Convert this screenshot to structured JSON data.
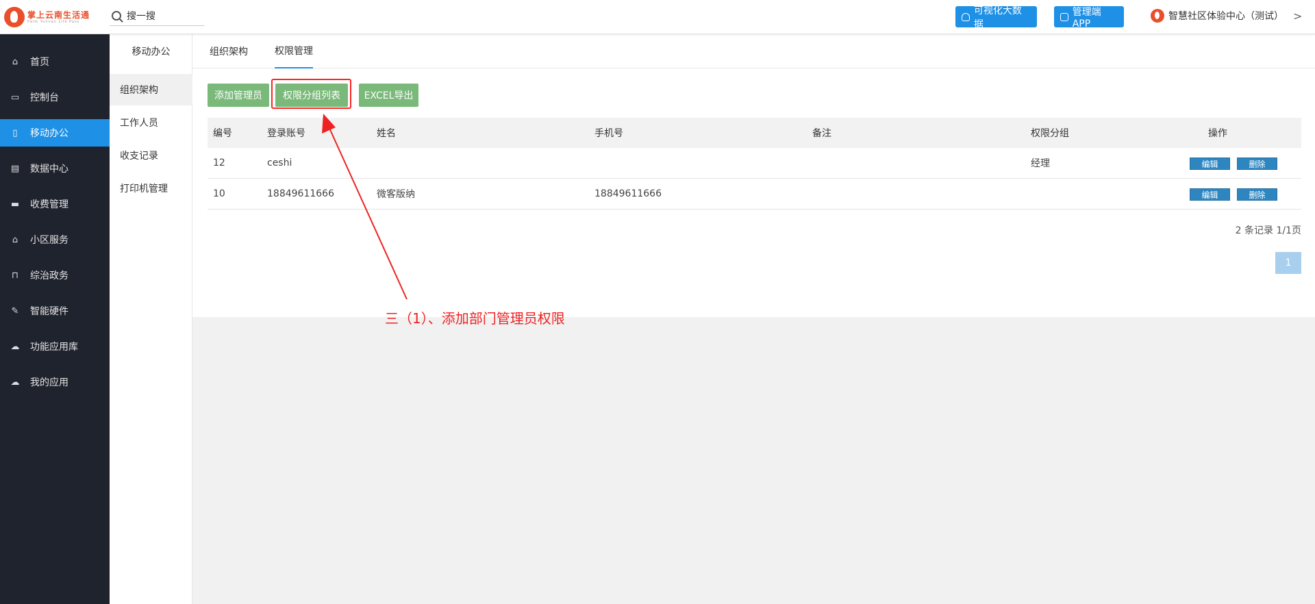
{
  "header": {
    "logo_text": "掌上云南生活通",
    "logo_subtext": "Palm Yunnan Life Pass",
    "search_label": "搜一搜",
    "btn_bigdata": "可视化大数据",
    "btn_app": "管理端APP",
    "org_name": "智慧社区体验中心（测试）",
    "org_chevron": ">"
  },
  "sidebar": {
    "items": [
      {
        "label": "首页",
        "icon": "home-icon",
        "glyph": "⌂"
      },
      {
        "label": "控制台",
        "icon": "laptop-icon",
        "glyph": "▭"
      },
      {
        "label": "移动办公",
        "icon": "mobile-icon",
        "glyph": "▯",
        "active": true
      },
      {
        "label": "数据中心",
        "icon": "briefcase-icon",
        "glyph": "▤"
      },
      {
        "label": "收费管理",
        "icon": "card-icon",
        "glyph": "▬"
      },
      {
        "label": "小区服务",
        "icon": "home-icon",
        "glyph": "⌂"
      },
      {
        "label": "综治政务",
        "icon": "bank-icon",
        "glyph": "⊓"
      },
      {
        "label": "智能硬件",
        "icon": "wrench-icon",
        "glyph": "✎"
      },
      {
        "label": "功能应用库",
        "icon": "cloud-upload-icon",
        "glyph": "☁"
      },
      {
        "label": "我的应用",
        "icon": "cloud-icon",
        "glyph": "☁"
      }
    ]
  },
  "subnav": {
    "title": "移动办公",
    "items": [
      {
        "label": "组织架构",
        "active": true
      },
      {
        "label": "工作人员"
      },
      {
        "label": "收支记录"
      },
      {
        "label": "打印机管理"
      }
    ]
  },
  "tabs": [
    {
      "label": "组织架构"
    },
    {
      "label": "权限管理",
      "active": true
    }
  ],
  "toolbar": {
    "add_admin": "添加管理员",
    "perm_groups": "权限分组列表",
    "export": "EXCEL导出"
  },
  "table": {
    "headers": [
      "编号",
      "登录账号",
      "姓名",
      "手机号",
      "备注",
      "权限分组",
      "操作"
    ],
    "rows": [
      {
        "id": "12",
        "account": "ceshi",
        "name": "",
        "phone": "",
        "note": "",
        "group": "经理",
        "edit": "编辑",
        "delete": "删除"
      },
      {
        "id": "10",
        "account": "18849611666",
        "name": "微客版纳",
        "phone": "18849611666",
        "note": "",
        "group": "",
        "edit": "编辑",
        "delete": "删除"
      }
    ]
  },
  "pagination": {
    "info": "2 条记录 1/1页",
    "current": "1"
  },
  "annotation": {
    "text": "三（1）、添加部门管理员权限",
    "color": "#ee2222"
  },
  "colors": {
    "accent": "#1e90e6",
    "sidebar_bg": "#1f232d",
    "green_btn": "#7ab97a",
    "action_btn": "#2e86c1"
  }
}
